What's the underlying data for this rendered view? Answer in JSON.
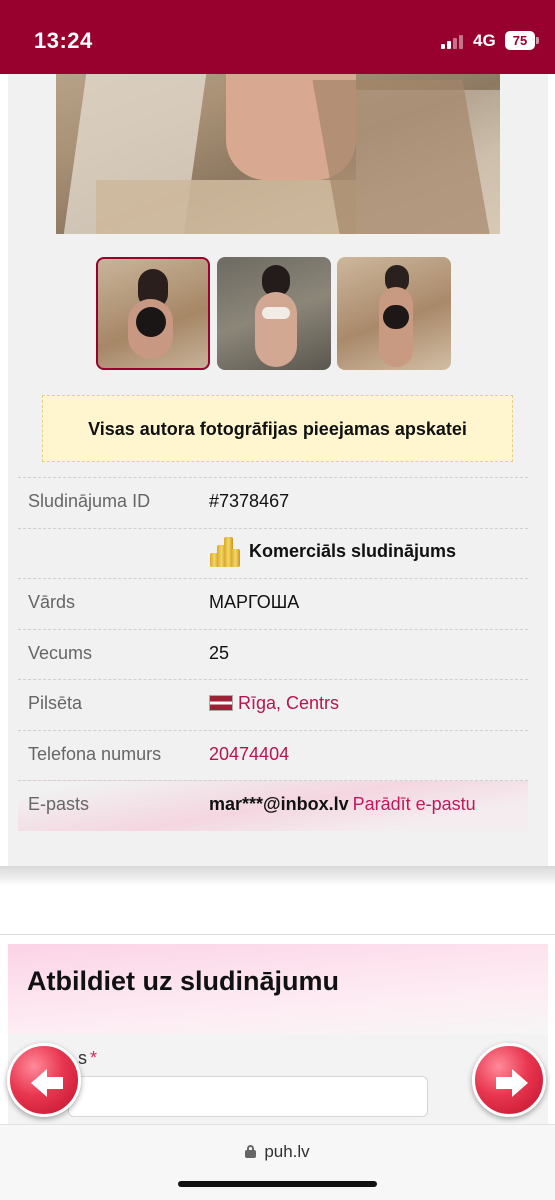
{
  "status_bar": {
    "time": "13:24",
    "network": "4G",
    "battery": "75"
  },
  "gallery": {
    "notice": "Visas autora fotogrāfijas pieejamas apskatei",
    "thumbnails": [
      "photo-1",
      "photo-2",
      "photo-3"
    ],
    "active_thumbnail": 1
  },
  "details": {
    "id_label": "Sludinājuma ID",
    "id_value": "#7378467",
    "commercial_label": "Komerciāls sludinājums",
    "name_label": "Vārds",
    "name_value": "МАРГОША",
    "age_label": "Vecums",
    "age_value": "25",
    "city_label": "Pilsēta",
    "city_value": "Rīga, Centrs",
    "phone_label": "Telefona numurs",
    "phone_value": "20474404",
    "email_label": "E-pasts",
    "email_value": "mar***@inbox.lv",
    "email_reveal": "Parādīt e-pastu"
  },
  "reply": {
    "title": "Atbildiet uz sludinājumu",
    "field_label_visible": "s",
    "required_mark": "*"
  },
  "browser": {
    "url": "puh.lv"
  },
  "colors": {
    "brand": "#98002e",
    "link": "#b8144e",
    "notice_bg": "#fff6cf"
  },
  "icons": [
    "signal-icon",
    "battery-icon",
    "coins-icon",
    "latvia-flag-icon",
    "arrow-left-icon",
    "arrow-right-icon",
    "lock-icon"
  ]
}
